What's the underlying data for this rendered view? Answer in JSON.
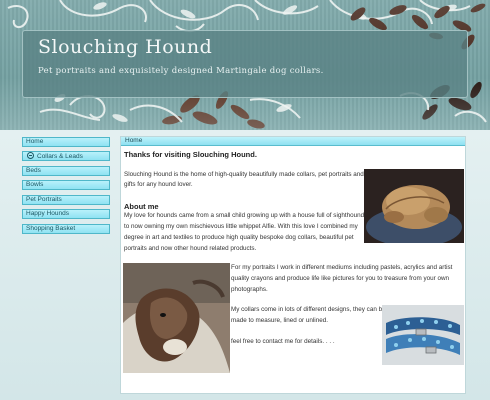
{
  "site": {
    "title": "Slouching Hound",
    "tagline": "Pet portraits and exquisitely designed Martingale dog collars."
  },
  "nav": {
    "items": [
      {
        "label": "Home",
        "icon": ""
      },
      {
        "label": "Collars & Leads",
        "icon": "circle-minus-icon"
      },
      {
        "label": "Beds",
        "icon": ""
      },
      {
        "label": "Bowls",
        "icon": ""
      },
      {
        "label": "Pet Portraits",
        "icon": ""
      },
      {
        "label": "Happy Hounds",
        "icon": ""
      },
      {
        "label": "Shopping Basket",
        "icon": ""
      }
    ]
  },
  "breadcrumb": {
    "label": "Home"
  },
  "content": {
    "welcome_heading": "Thanks for visiting Slouching Hound.",
    "intro_line1": "Slouching Hound is the home of high-quality beautifully made collars, pet portraits and",
    "intro_line2": "gifts for any hound lover.",
    "about_heading": "About me",
    "about_line1": "My love for hounds came from a small child growing up with a house full of sighthounds",
    "about_line2": "to now owning my own mischievous little whippet Alfie. With this love I combined my",
    "about_line3": "degree in art and textiles to produce high quality bespoke dog collars, beautiful pet",
    "about_line4": "portraits and now other hound related products.",
    "portraits_line1": "For my portraits I work in different mediums including pastels, acrylics and artist",
    "portraits_line2": "quality crayons and produce life like pictures for you to treasure from your own",
    "portraits_line3": "photographs.",
    "collars_line1": "My collars come in lots of different designs, they can be",
    "collars_line2": "made to measure, lined or unlined.",
    "contact_line": "feel free to contact me for details. . . ."
  },
  "colors": {
    "nav_fill": "#8fe2f2",
    "nav_border": "#4fb7c9",
    "header_teal": "#6f9a9b",
    "page_bg": "#d6e8ea"
  }
}
